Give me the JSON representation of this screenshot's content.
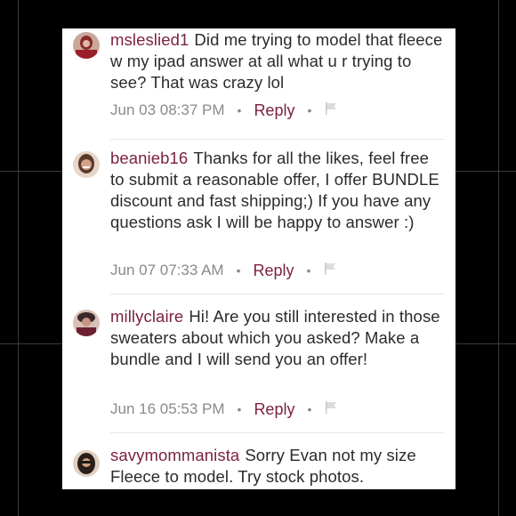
{
  "comments": [
    {
      "username": "msleslied1",
      "text": "Did me trying to model that fleece w my ipad answer at all what u r trying to see?  That was crazy lol",
      "timestamp": "Jun 03 08:37 PM",
      "reply_label": "Reply",
      "avatar_color": "#8a2a2a"
    },
    {
      "username": "beanieb16",
      "text": "Thanks for all the likes, feel free to submit a reasonable offer, I offer BUNDLE discount and fast shipping;) If you have any questions ask I will be happy to answer :)",
      "timestamp": "Jun 07 07:33 AM",
      "reply_label": "Reply",
      "avatar_color": "#b98a70"
    },
    {
      "username": "millyclaire",
      "text": "Hi! Are you still interested in those sweaters about which you asked? Make a bundle and I will send you an offer!",
      "timestamp": "Jun 16 05:53 PM",
      "reply_label": "Reply",
      "avatar_color": "#6b2030"
    },
    {
      "username": "savymommanista",
      "text": "Sorry Evan not my size Fleece to model. Try stock photos.",
      "avatar_color": "#5a4a3a"
    }
  ],
  "colors": {
    "username": "#7b2242",
    "text": "#2b2b2b",
    "meta": "#8a8a8a",
    "background": "#000000",
    "panel": "#ffffff"
  }
}
